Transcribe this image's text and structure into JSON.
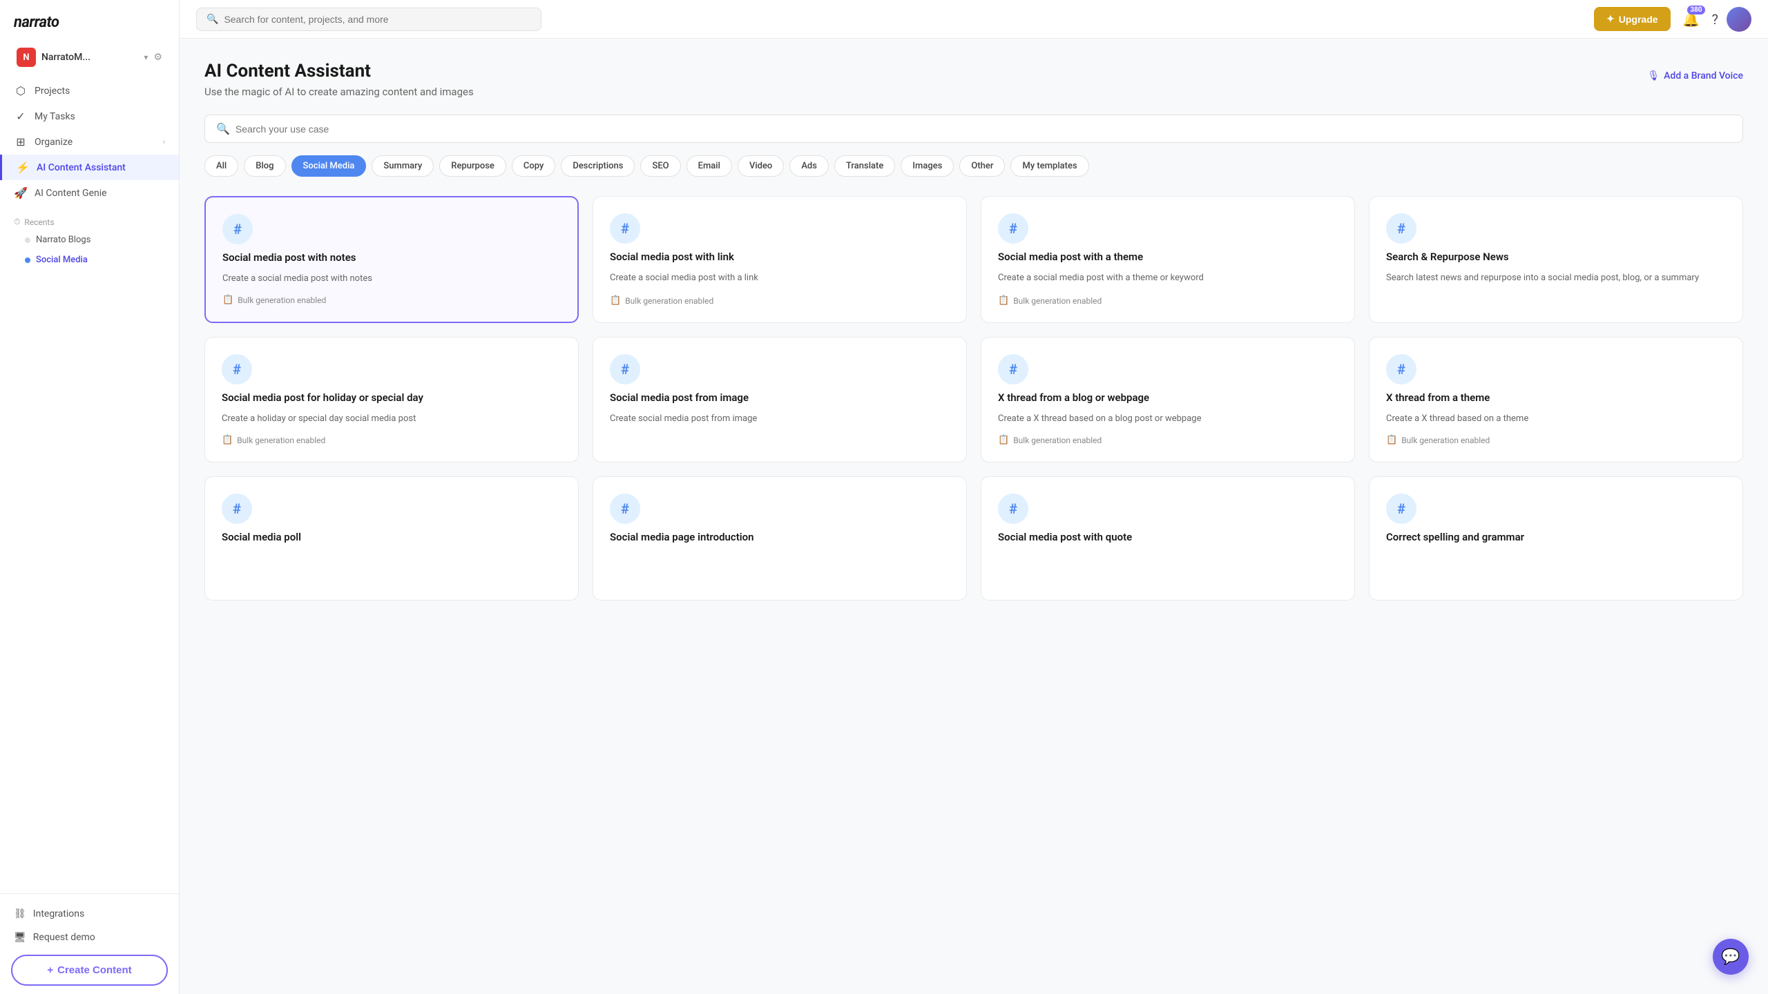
{
  "brand": "narrato",
  "sidebar": {
    "workspace": {
      "initial": "N",
      "name": "NarratoM...",
      "chevron": "▾",
      "gear": "⚙"
    },
    "nav_items": [
      {
        "id": "projects",
        "icon": "⬡",
        "label": "Projects"
      },
      {
        "id": "my-tasks",
        "icon": "✓",
        "label": "My Tasks"
      },
      {
        "id": "organize",
        "icon": "⊞",
        "label": "Organize",
        "arrow": "›"
      },
      {
        "id": "ai-content-assistant",
        "icon": "⚡",
        "label": "AI Content Assistant",
        "active": true
      },
      {
        "id": "ai-content-genie",
        "icon": "🚀",
        "label": "AI Content Genie"
      }
    ],
    "recents": {
      "label": "Recents",
      "items": [
        {
          "id": "narrato-blogs",
          "label": "Narrato Blogs",
          "dot_color": "default"
        },
        {
          "id": "social-media",
          "label": "Social Media",
          "dot_color": "blue",
          "active": true
        }
      ]
    },
    "bottom_items": [
      {
        "id": "integrations",
        "icon": "⛓",
        "label": "Integrations"
      },
      {
        "id": "request-demo",
        "icon": "🖥",
        "label": "Request demo"
      }
    ],
    "create_btn": "+ Create Content"
  },
  "topbar": {
    "search_placeholder": "Search for content, projects, and more",
    "upgrade_label": "Upgrade",
    "upgrade_icon": "✦",
    "notif_count": "380",
    "help_icon": "?",
    "bell_icon": "🔔"
  },
  "page": {
    "title": "AI Content Assistant",
    "subtitle": "Use the magic of AI to create amazing content and images",
    "brand_voice": "Add a Brand Voice",
    "use_case_placeholder": "Search your use case"
  },
  "filter_chips": [
    {
      "id": "all",
      "label": "All"
    },
    {
      "id": "blog",
      "label": "Blog"
    },
    {
      "id": "social-media",
      "label": "Social Media",
      "active": true
    },
    {
      "id": "summary",
      "label": "Summary"
    },
    {
      "id": "repurpose",
      "label": "Repurpose"
    },
    {
      "id": "copy",
      "label": "Copy"
    },
    {
      "id": "descriptions",
      "label": "Descriptions"
    },
    {
      "id": "seo",
      "label": "SEO"
    },
    {
      "id": "email",
      "label": "Email"
    },
    {
      "id": "video",
      "label": "Video"
    },
    {
      "id": "ads",
      "label": "Ads"
    },
    {
      "id": "translate",
      "label": "Translate"
    },
    {
      "id": "images",
      "label": "Images"
    },
    {
      "id": "other",
      "label": "Other"
    },
    {
      "id": "my-templates",
      "label": "My templates"
    }
  ],
  "cards": [
    {
      "id": "social-notes",
      "icon": "#",
      "title": "Social media post with notes",
      "desc": "Create a social media post with notes",
      "bulk": "Bulk generation enabled",
      "selected": true
    },
    {
      "id": "social-link",
      "icon": "#",
      "title": "Social media post with link",
      "desc": "Create a social media post with a link",
      "bulk": "Bulk generation enabled"
    },
    {
      "id": "social-theme",
      "icon": "#",
      "title": "Social media post with a theme",
      "desc": "Create a social media post with a theme or keyword",
      "bulk": "Bulk generation enabled"
    },
    {
      "id": "search-repurpose",
      "icon": "#",
      "title": "Search & Repurpose News",
      "desc": "Search latest news and repurpose into a social media post, blog, or a summary",
      "bulk": null
    },
    {
      "id": "social-holiday",
      "icon": "#",
      "title": "Social media post for holiday or special day",
      "desc": "Create a holiday or special day social media post",
      "bulk": "Bulk generation enabled"
    },
    {
      "id": "social-image",
      "icon": "#",
      "title": "Social media post from image",
      "desc": "Create social media post from image",
      "bulk": null
    },
    {
      "id": "x-thread-blog",
      "icon": "#",
      "title": "X thread from a blog or webpage",
      "desc": "Create a X thread based on a blog post or webpage",
      "bulk": "Bulk generation enabled"
    },
    {
      "id": "x-thread-theme",
      "icon": "#",
      "title": "X thread from a theme",
      "desc": "Create a X thread based on a theme",
      "bulk": "Bulk generation enabled"
    },
    {
      "id": "social-poll",
      "icon": "#",
      "title": "Social media poll",
      "desc": "",
      "bulk": null
    },
    {
      "id": "social-page-intro",
      "icon": "#",
      "title": "Social media page introduction",
      "desc": "",
      "bulk": null
    },
    {
      "id": "social-quote",
      "icon": "#",
      "title": "Social media post with quote",
      "desc": "",
      "bulk": null
    },
    {
      "id": "correct-spelling",
      "icon": "#",
      "title": "Correct spelling and grammar",
      "desc": "",
      "bulk": null
    }
  ],
  "chat_bubble_icon": "💬"
}
